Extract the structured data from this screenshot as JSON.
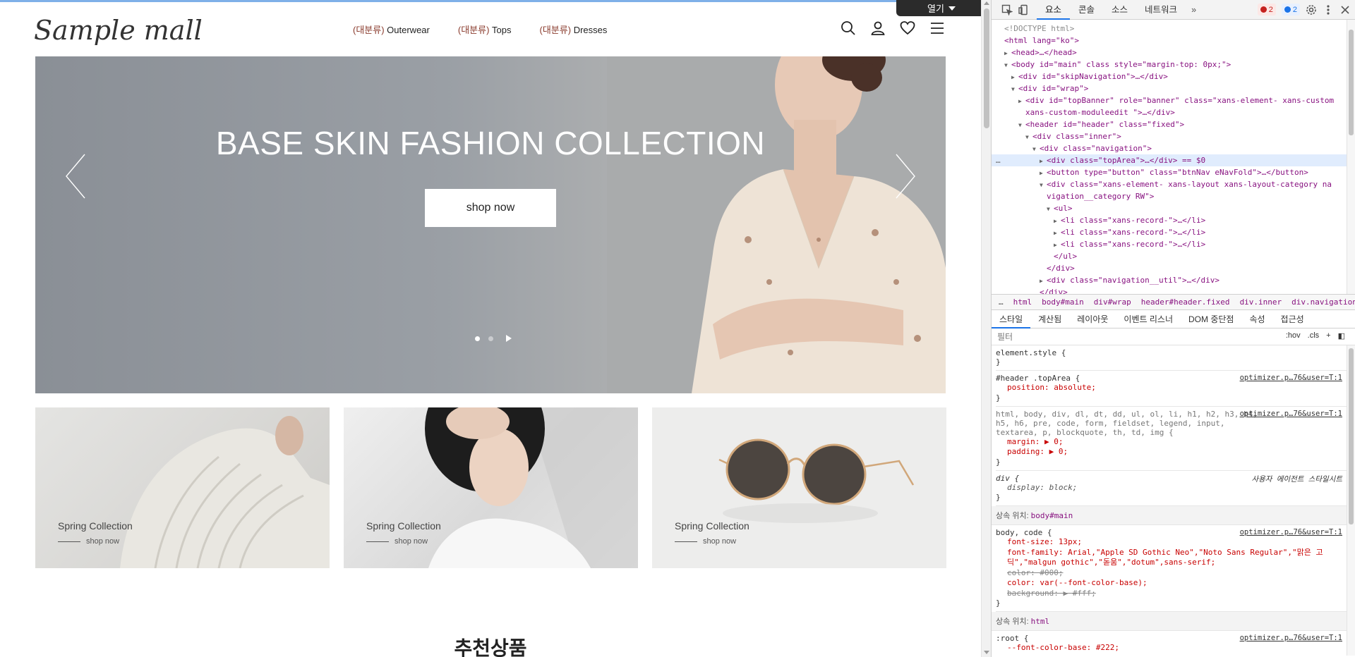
{
  "site": {
    "logo_text": "Sample mall",
    "nav": [
      {
        "cat": "(대분류)",
        "label": "Outerwear"
      },
      {
        "cat": "(대분류)",
        "label": "Tops"
      },
      {
        "cat": "(대분류)",
        "label": "Dresses"
      }
    ],
    "open_button": "열기",
    "hero": {
      "headline": "BASE SKIN FASHION COLLECTION",
      "cta": "shop now",
      "slides": 2,
      "active_slide": 1
    },
    "banners": [
      {
        "title": "Spring Collection",
        "link": "shop now"
      },
      {
        "title": "Spring Collection",
        "link": "shop now"
      },
      {
        "title": "Spring Collection",
        "link": "shop now"
      }
    ],
    "section_title": "추천상품"
  },
  "devtools": {
    "tabs": [
      "요소",
      "콘솔",
      "소스",
      "네트워크"
    ],
    "more_tabs": "»",
    "errors": "2",
    "messages": "2",
    "dom": [
      {
        "indent": 0,
        "tw": "",
        "html": "<span class='cmt'>&lt;!DOCTYPE html&gt;</span>",
        "text": "<!DOCTYPE html>"
      },
      {
        "indent": 0,
        "tw": "",
        "text": "<html lang=\"ko\">"
      },
      {
        "indent": 1,
        "tw": "▶",
        "text": "<head>…</head>"
      },
      {
        "indent": 1,
        "tw": "▼",
        "text": "<body id=\"main\" class style=\"margin-top: 0px;\">"
      },
      {
        "indent": 2,
        "tw": "▶",
        "text": "<div id=\"skipNavigation\">…</div>"
      },
      {
        "indent": 2,
        "tw": "▼",
        "text": "<div id=\"wrap\">"
      },
      {
        "indent": 3,
        "tw": "▶",
        "text": "<div id=\"topBanner\" role=\"banner\" class=\"xans-element- xans-custom"
      },
      {
        "indent": 3,
        "tw": "",
        "text": "xans-custom-moduleedit \">…</div>"
      },
      {
        "indent": 3,
        "tw": "▼",
        "text": "<header id=\"header\" class=\"fixed\">"
      },
      {
        "indent": 4,
        "tw": "▼",
        "text": "<div class=\"inner\">"
      },
      {
        "indent": 5,
        "tw": "▼",
        "text": "<div class=\"navigation\">"
      },
      {
        "indent": 6,
        "tw": "▶",
        "text": "<div class=\"topArea\">…</div> == $0",
        "selected": true
      },
      {
        "indent": 6,
        "tw": "▶",
        "text": "<button type=\"button\" class=\"btnNav eNavFold\">…</button>"
      },
      {
        "indent": 6,
        "tw": "▼",
        "text": "<div class=\"xans-element- xans-layout xans-layout-category na"
      },
      {
        "indent": 6,
        "tw": "",
        "text": "vigation__category RW\">"
      },
      {
        "indent": 7,
        "tw": "▼",
        "text": "<ul>"
      },
      {
        "indent": 8,
        "tw": "▶",
        "text": "<li class=\"xans-record-\">…</li>"
      },
      {
        "indent": 8,
        "tw": "▶",
        "text": "<li class=\"xans-record-\">…</li>"
      },
      {
        "indent": 8,
        "tw": "▶",
        "text": "<li class=\"xans-record-\">…</li>"
      },
      {
        "indent": 7,
        "tw": "",
        "text": "</ul>"
      },
      {
        "indent": 6,
        "tw": "",
        "text": "</div>"
      },
      {
        "indent": 6,
        "tw": "▶",
        "text": "<div class=\"navigation__util\">…</div>"
      },
      {
        "indent": 5,
        "tw": "",
        "text": "</div>"
      }
    ],
    "breadcrumbs": [
      "…",
      "html",
      "body#main",
      "div#wrap",
      "header#header.fixed",
      "div.inner",
      "div.navigation",
      "…"
    ],
    "sub_tabs": [
      "스타일",
      "계산됨",
      "레이아웃",
      "이벤트 리스너",
      "DOM 중단점",
      "속성",
      "접근성"
    ],
    "filter_placeholder": "필터",
    "filter_tools": [
      ":hov",
      ".cls",
      "+"
    ],
    "styles": {
      "element_style": "element.style {",
      "rule1": {
        "selector": "#header .topArea {",
        "source": "optimizer.p…76&user=T:1",
        "decl": "position: absolute;"
      },
      "rule2": {
        "selector": "html, body, div, dl, dt, dd, ul, ol, li, h1, h2, h3, h4, h5, h6, pre, code, form, fieldset, legend, input, textarea, p, blockquote, th, td, img {",
        "source": "optimizer.p…76&user=T:1",
        "decl1": "margin: ▶ 0;",
        "decl2": "padding: ▶ 0;"
      },
      "rule3": {
        "selector": "div {",
        "source": "사용자 에이전트 스타일시트",
        "decl": "display: block;"
      },
      "inherit1": {
        "label": "상속 위치:",
        "target": "body#main"
      },
      "rule4": {
        "selector": "body, code {",
        "source": "optimizer.p…76&user=T:1",
        "decl1": "font-size: 13px;",
        "decl2": "font-family: Arial,\"Apple SD Gothic Neo\",\"Noto Sans Regular\",\"맑은 고딕\",\"malgun gothic\",\"돋움\",\"dotum\",sans-serif;",
        "decl3": "color: #000;",
        "decl4": "color: var(--font-color-base);",
        "decl5": "background: ▶ #fff;"
      },
      "inherit2": {
        "label": "상속 위치:",
        "target": "html"
      },
      "rule5": {
        "selector": ":root {",
        "source": "optimizer.p…76&user=T:1",
        "decl": "--font-color-base: #222;"
      }
    }
  }
}
